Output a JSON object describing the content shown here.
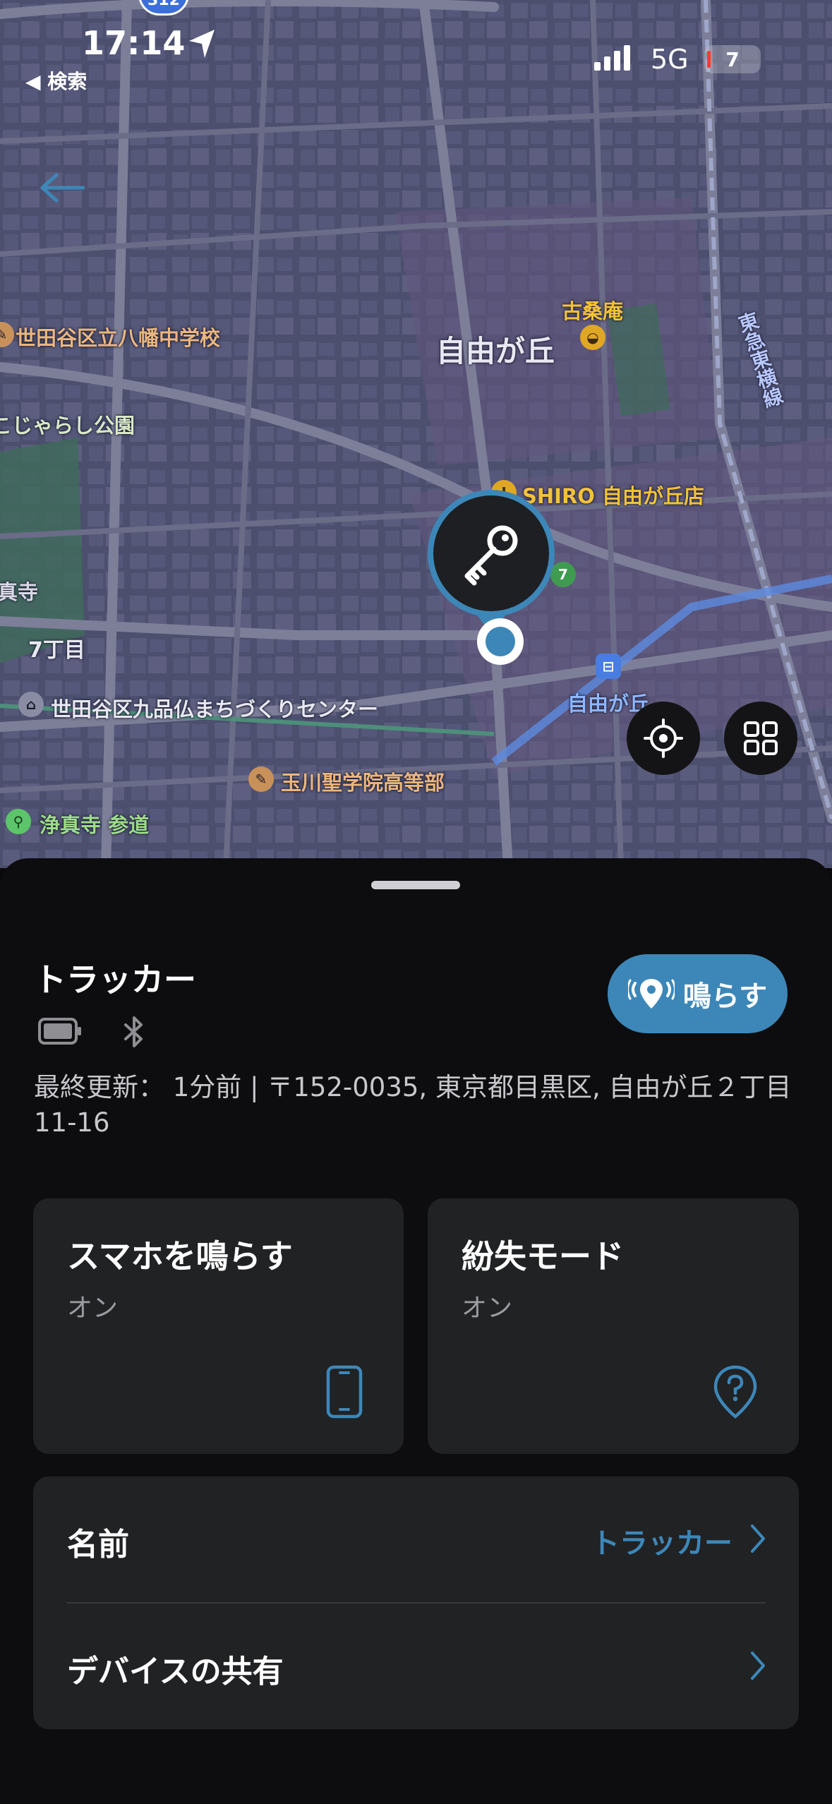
{
  "status_bar": {
    "time": "17:14",
    "back_label": "◀ 検索",
    "network": "5G",
    "battery": "7",
    "route_shield": "312"
  },
  "map": {
    "labels": {
      "school_yahata": "世田谷区立八幡中学校",
      "park": "こじゃらし公園",
      "jiyugaoka": "自由が丘",
      "kokuwan": "古桑庵",
      "shiro": "SHIRO 自由が丘店",
      "temple": "真寺",
      "chome7": "7丁目",
      "center": "世田谷区九品仏まちづくりセンター",
      "station": "自由が丘",
      "tamagawa": "玉川聖学院高等部",
      "joshinji": "浄真寺 参道",
      "toyoko_line": "東急東横線"
    }
  },
  "device": {
    "name": "トラッカー",
    "ring_button": "鳴らす",
    "last_updated": "最終更新： 1分前 | 〒152-0035, 東京都目黒区, 自由が丘２丁目11-16"
  },
  "cards": {
    "ring_phone": {
      "title": "スマホを鳴らす",
      "status": "オン"
    },
    "lost_mode": {
      "title": "紛失モード",
      "status": "オン"
    }
  },
  "settings": {
    "name_label": "名前",
    "name_value": "トラッカー",
    "share_label": "デバイスの共有"
  },
  "colors": {
    "accent": "#3d87b8",
    "sheet_bg": "#0d0d0f",
    "card_bg": "#212224"
  }
}
